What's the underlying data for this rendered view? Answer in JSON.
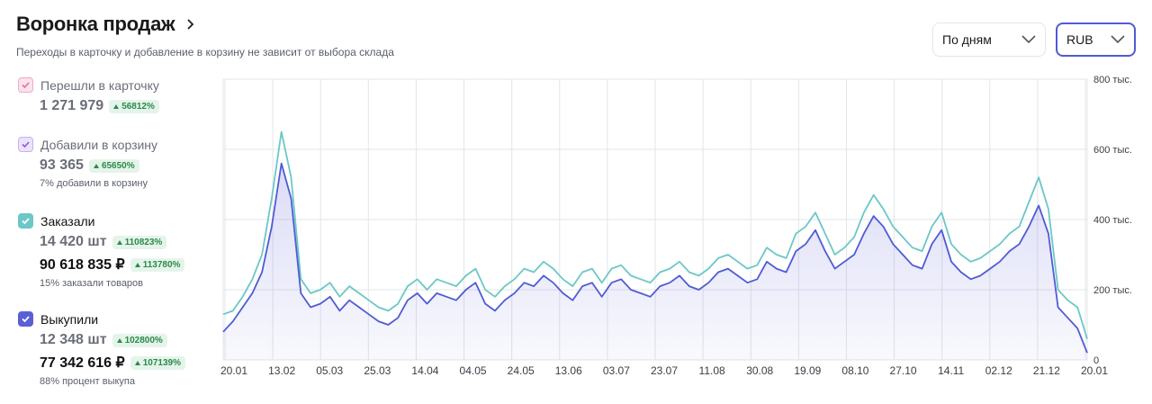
{
  "header": {
    "title": "Воронка продаж",
    "subtitle": "Переходы в карточку и добавление в корзину не зависит от выбора склада"
  },
  "controls": {
    "period": "По дням",
    "currency": "RUB"
  },
  "legend": [
    {
      "label": "Перешли в карточку",
      "value": "1 271 979",
      "badge": "56812%",
      "color": "#f4a7c9"
    },
    {
      "label": "Добавили в корзину",
      "value": "93 365",
      "badge": "65650%",
      "note": "7% добавили в корзину",
      "color": "#8a5bd6"
    },
    {
      "label": "Заказали",
      "value": "14 420 шт",
      "badge": "110823%",
      "value2": "90 618 835 ₽",
      "badge2": "113780%",
      "note": "15% заказали товаров",
      "color": "#6cc7c7"
    },
    {
      "label": "Выкупили",
      "value": "12 348 шт",
      "badge": "102800%",
      "value2": "77 342 616 ₽",
      "badge2": "107139%",
      "note": "88% процент выкупа",
      "color": "#5b5fd6"
    }
  ],
  "chart_data": {
    "type": "line",
    "x_ticks": [
      "20.01",
      "13.02",
      "05.03",
      "25.03",
      "14.04",
      "04.05",
      "24.05",
      "13.06",
      "03.07",
      "23.07",
      "11.08",
      "30.08",
      "19.09",
      "08.10",
      "27.10",
      "14.11",
      "02.12",
      "21.12",
      "20.01"
    ],
    "y_ticks": [
      "0",
      "200 тыс.",
      "400 тыс.",
      "600 тыс.",
      "800 тыс."
    ],
    "ylim": [
      0,
      800000
    ],
    "series": [
      {
        "name": "Заказали",
        "color": "#6cc7c7",
        "values": [
          130,
          140,
          180,
          230,
          300,
          460,
          650,
          520,
          230,
          190,
          200,
          220,
          180,
          210,
          190,
          170,
          150,
          140,
          160,
          210,
          230,
          200,
          230,
          220,
          210,
          240,
          260,
          200,
          180,
          210,
          230,
          260,
          250,
          280,
          260,
          230,
          210,
          250,
          260,
          220,
          260,
          270,
          240,
          230,
          220,
          250,
          260,
          280,
          250,
          240,
          260,
          290,
          300,
          280,
          260,
          270,
          320,
          300,
          290,
          360,
          380,
          420,
          360,
          300,
          320,
          350,
          420,
          470,
          430,
          380,
          350,
          320,
          310,
          380,
          420,
          330,
          300,
          280,
          290,
          310,
          330,
          360,
          380,
          450,
          520,
          430,
          200,
          170,
          150,
          60
        ]
      },
      {
        "name": "Выкупили",
        "color": "#4f5bd5",
        "values": [
          80,
          110,
          150,
          190,
          250,
          380,
          560,
          460,
          190,
          150,
          160,
          180,
          140,
          170,
          150,
          130,
          110,
          100,
          120,
          170,
          190,
          160,
          190,
          180,
          170,
          200,
          220,
          160,
          140,
          170,
          190,
          220,
          210,
          240,
          220,
          190,
          170,
          210,
          220,
          180,
          220,
          230,
          200,
          190,
          180,
          210,
          220,
          240,
          210,
          200,
          220,
          250,
          260,
          240,
          220,
          230,
          280,
          260,
          250,
          310,
          330,
          370,
          310,
          260,
          280,
          300,
          360,
          410,
          380,
          330,
          300,
          270,
          260,
          330,
          370,
          280,
          250,
          230,
          240,
          260,
          280,
          310,
          330,
          380,
          440,
          360,
          150,
          120,
          90,
          20
        ]
      }
    ]
  }
}
